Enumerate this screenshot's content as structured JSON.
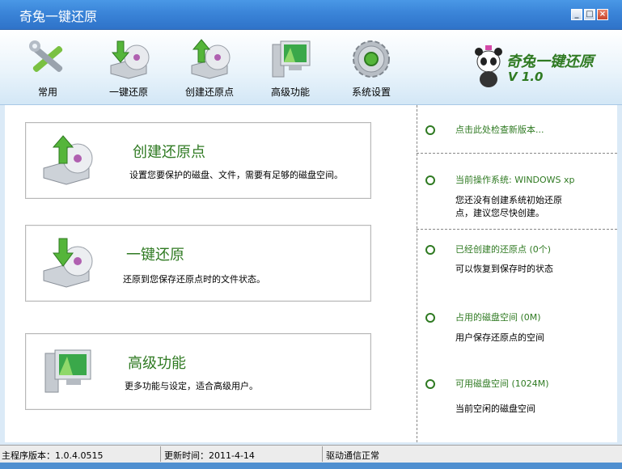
{
  "window": {
    "title": "奇兔一键还原"
  },
  "toolbar": {
    "items": [
      {
        "label": "常用",
        "icon": "tools-icon"
      },
      {
        "label": "一键还原",
        "icon": "restore-disk-icon"
      },
      {
        "label": "创建还原点",
        "icon": "create-restore-point-icon"
      },
      {
        "label": "高级功能",
        "icon": "computer-icon"
      },
      {
        "label": "系统设置",
        "icon": "gear-icon"
      }
    ],
    "brand": {
      "name": "奇兔一键还原",
      "version": "V 1.0"
    }
  },
  "cards": [
    {
      "title": "创建还原点",
      "desc": "设置您要保护的磁盘、文件，需要有足够的磁盘空间。"
    },
    {
      "title": "一键还原",
      "desc": "还原到您保存还原点时的文件状态。"
    },
    {
      "title": "高级功能",
      "desc": "更多功能与设定，适合高级用户。"
    }
  ],
  "info": {
    "check_update": "点击此处检查新版本...",
    "os_label": "当前操作系统: WINDOWS xp",
    "os_note_line1": "您还没有创建系统初始还原",
    "os_note_line2": "点，建议您尽快创建。",
    "restore_points": "已经创建的还原点 (0个)",
    "restore_points_note": "可以恢复到保存时的状态",
    "used_space": "占用的磁盘空间 (0M)",
    "used_space_note": "用户保存还原点的空间",
    "free_space": "可用磁盘空间 (1024M)",
    "free_space_note": "当前空闲的磁盘空间"
  },
  "status": {
    "version": "主程序版本：1.0.4.0515",
    "updated": "更新时间：2011-4-14",
    "driver": "驱动通信正常"
  },
  "colors": {
    "accent_green": "#2f7a22",
    "titlebar_blue": "#3a84d8"
  }
}
